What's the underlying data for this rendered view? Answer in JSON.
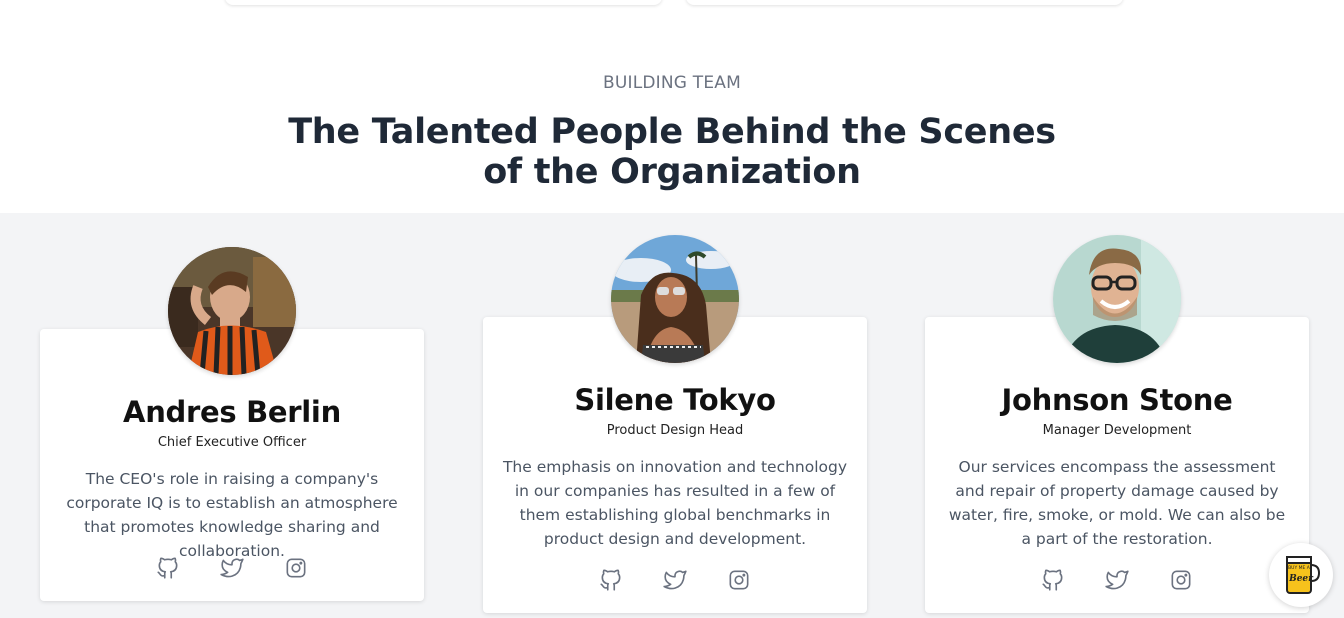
{
  "section": {
    "eyebrow": "BUILDING TEAM",
    "title_line1": "The Talented People Behind the Scenes",
    "title_line2": "of the Organization"
  },
  "team": [
    {
      "name": "Andres Berlin",
      "role": "Chief Executive Officer",
      "bio": "The CEO's role in raising a company's corporate IQ is to establish an atmosphere that promotes knowledge sharing and collaboration.",
      "socials": [
        "github-icon",
        "twitter-icon",
        "instagram-icon"
      ]
    },
    {
      "name": "Silene Tokyo",
      "role": "Product Design Head",
      "bio": "The emphasis on innovation and technology in our companies has resulted in a few of them establishing global benchmarks in product design and development.",
      "socials": [
        "github-icon",
        "twitter-icon",
        "instagram-icon"
      ]
    },
    {
      "name": "Johnson Stone",
      "role": "Manager Development",
      "bio": "Our services encompass the assessment and repair of property damage caused by water, fire, smoke, or mold. We can also be a part of the restoration.",
      "socials": [
        "github-icon",
        "twitter-icon",
        "instagram-icon"
      ]
    }
  ],
  "badge": {
    "icon": "buy-me-a-beer-icon",
    "text_top": "BUY ME A",
    "text_bottom": "Beer"
  },
  "colors": {
    "heading": "#1f2937",
    "muted": "#6b7280",
    "section_bg": "#f3f4f6"
  }
}
